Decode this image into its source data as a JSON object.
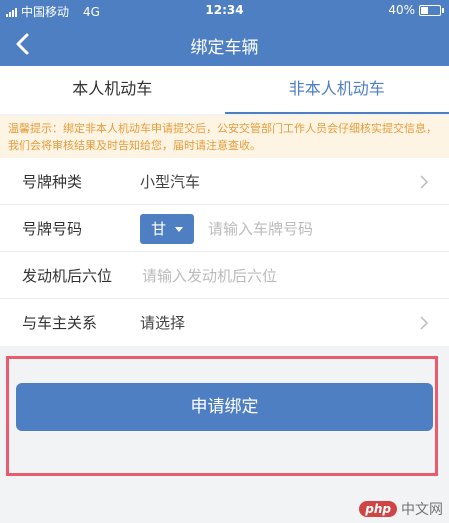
{
  "status_bar": {
    "carrier": "中国移动",
    "network": "4G",
    "time": "12:34",
    "battery": "40%",
    "battery_level": 0.4
  },
  "nav": {
    "back_icon": "chevron-left-icon",
    "title": "绑定车辆"
  },
  "tabs": [
    {
      "label": "本人机动车",
      "active": false
    },
    {
      "label": "非本人机动车",
      "active": true
    }
  ],
  "notice": {
    "text": "温馨提示：绑定非本人机动车申请提交后，公安交管部门工作人员会仔细核实提交信息，我们会将审核结果及时告知给您，届时请注意查收。"
  },
  "form": {
    "plate_type": {
      "label": "号牌种类",
      "value": "小型汽车"
    },
    "plate_number": {
      "label": "号牌号码",
      "province": "甘",
      "placeholder": "请输入车牌号码"
    },
    "engine": {
      "label": "发动机后六位",
      "placeholder": "请输入发动机后六位"
    },
    "relation": {
      "label": "与车主关系",
      "value": "请选择"
    }
  },
  "submit": {
    "label": "申请绑定"
  },
  "watermark": {
    "logo": "php",
    "text": "中文网"
  },
  "colors": {
    "primary": "#4f7fc3",
    "notice_bg": "#fdf4e3",
    "notice_text": "#e69c3a",
    "highlight": "#ec5a6e"
  }
}
